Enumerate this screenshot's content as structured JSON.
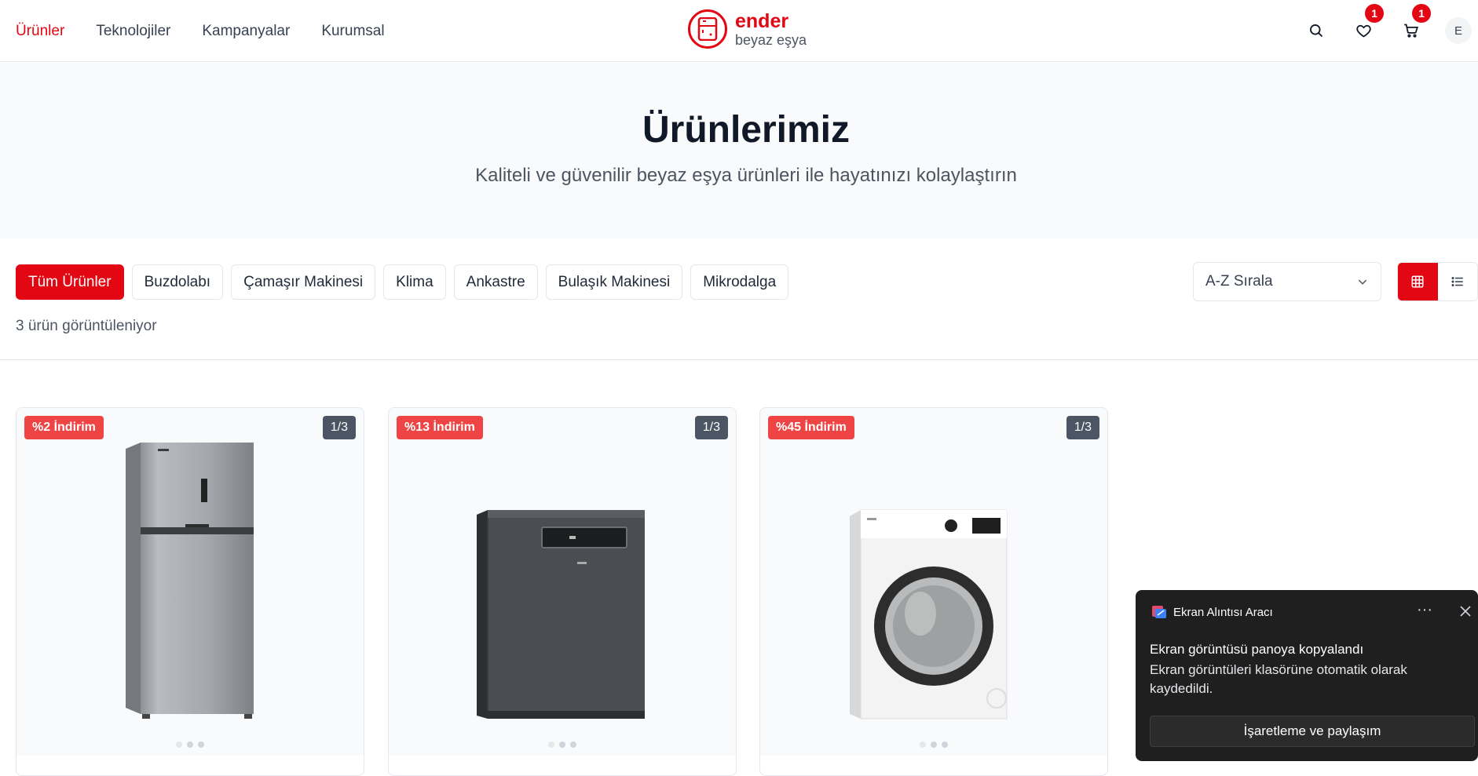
{
  "nav": {
    "items": [
      {
        "label": "Ürünler",
        "active": true
      },
      {
        "label": "Teknolojiler",
        "active": false
      },
      {
        "label": "Kampanyalar",
        "active": false
      },
      {
        "label": "Kurumsal",
        "active": false
      }
    ]
  },
  "brand": {
    "name": "ender",
    "tagline": "beyaz eşya",
    "color": "#e30613"
  },
  "header": {
    "favorites_count": "1",
    "cart_count": "1",
    "avatar_initial": "E"
  },
  "hero": {
    "title": "Ürünlerimiz",
    "subtitle": "Kaliteli ve güvenilir beyaz eşya ürünleri ile hayatınızı kolaylaştırın"
  },
  "filters": {
    "categories": [
      "Tüm Ürünler",
      "Buzdolabı",
      "Çamaşır Makinesi",
      "Klima",
      "Ankastre",
      "Bulaşık Makinesi",
      "Mikrodalga"
    ],
    "active_index": 0,
    "sort_label": "A-Z Sırala",
    "view_mode": "grid"
  },
  "results": {
    "count_text": "3 ürün görüntüleniyor"
  },
  "products": [
    {
      "discount": "%2 İndirim",
      "image_index": "1/3",
      "image": "refrigerator"
    },
    {
      "discount": "%13 İndirim",
      "image_index": "1/3",
      "image": "dishwasher"
    },
    {
      "discount": "%45 İndirim",
      "image_index": "1/3",
      "image": "washing-machine"
    }
  ],
  "toast": {
    "app_name": "Ekran Alıntısı Aracı",
    "title": "Ekran görüntüsü panoya kopyalandı",
    "body": "Ekran görüntüleri klasörüne otomatik olarak kaydedildi.",
    "button": "İşaretleme ve paylaşım"
  }
}
